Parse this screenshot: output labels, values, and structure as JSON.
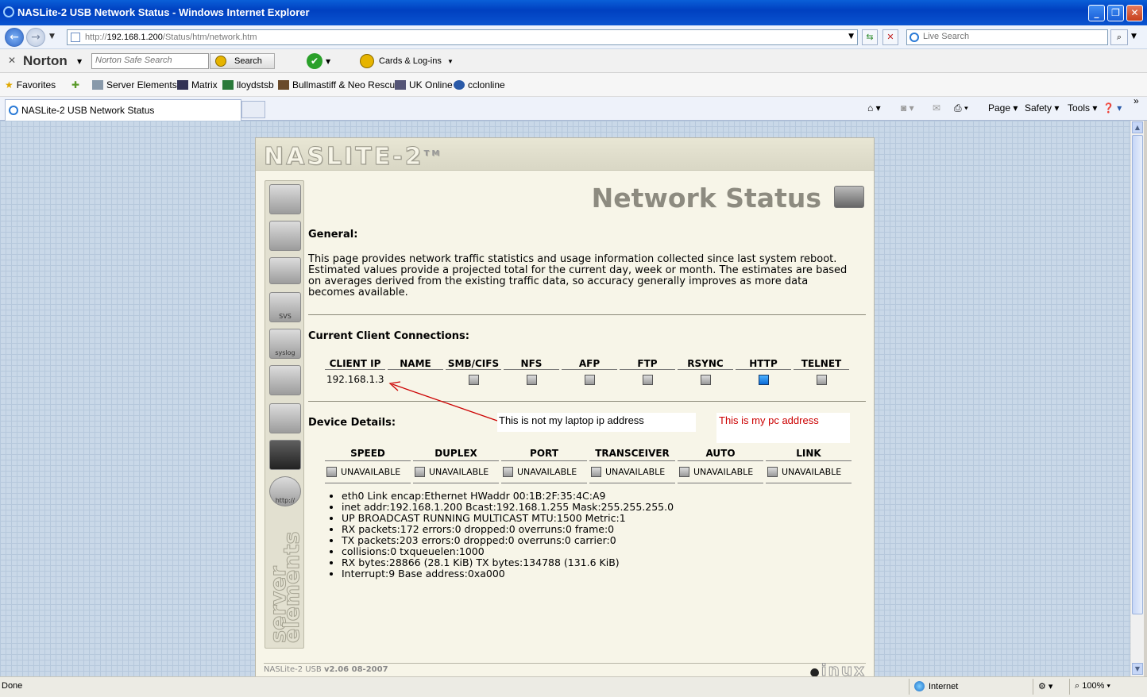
{
  "window": {
    "title": "NASLite-2 USB Network Status - Windows Internet Explorer"
  },
  "address": {
    "url_prefix": "http://",
    "url_host": "192.168.1.200",
    "url_path": "/Status/htm/network.htm",
    "search_placeholder": "Live Search"
  },
  "norton": {
    "brand": "Norton",
    "search_placeholder": "Norton Safe Search",
    "search_button": "Search",
    "cards_label": "Cards & Log-ins"
  },
  "favorites": {
    "label": "Favorites",
    "items": [
      "Server Elements",
      "Matrix",
      "lloydstsb",
      "Bullmastiff & Neo Rescue",
      "UK Online",
      "cclonline"
    ]
  },
  "tab": {
    "label": "NASLite-2 USB Network Status"
  },
  "commands": {
    "page": "Page",
    "safety": "Safety",
    "tools": "Tools"
  },
  "naslite": {
    "logo": "NASLITE-2",
    "tm": "TM",
    "sidebar_labels": {
      "svs": "SVS",
      "syslog": "syslog",
      "http": "http://"
    },
    "sidebar_vertical": "server elements",
    "page_title": "Network Status",
    "general_heading": "General:",
    "general_text": "This page provides network traffic statistics and usage information collected since last system reboot. Estimated values provide a projected total for the current day, week or month. The estimates are based on averages derived from the existing traffic data, so accuracy generally improves as more data becomes available.",
    "clients_heading": "Current Client Connections:",
    "client_columns": [
      "CLIENT IP",
      "NAME",
      "SMB/CIFS",
      "NFS",
      "AFP",
      "FTP",
      "RSYNC",
      "HTTP",
      "TELNET"
    ],
    "client_rows": [
      {
        "ip": "192.168.1.3",
        "name": "",
        "smb": false,
        "nfs": false,
        "afp": false,
        "ftp": false,
        "rsync": false,
        "http": true,
        "telnet": false
      }
    ],
    "device_heading": "Device Details:",
    "device_columns": [
      "SPEED",
      "DUPLEX",
      "PORT",
      "TRANSCEIVER",
      "AUTO",
      "LINK"
    ],
    "device_values": [
      "UNAVAILABLE",
      "UNAVAILABLE",
      "UNAVAILABLE",
      "UNAVAILABLE",
      "UNAVAILABLE",
      "UNAVAILABLE"
    ],
    "interface_lines": [
      "eth0 Link encap:Ethernet HWaddr 00:1B:2F:35:4C:A9",
      "inet addr:192.168.1.200 Bcast:192.168.1.255 Mask:255.255.255.0",
      "UP BROADCAST RUNNING MULTICAST MTU:1500 Metric:1",
      "RX packets:172 errors:0 dropped:0 overruns:0 frame:0",
      "TX packets:203 errors:0 dropped:0 overruns:0 carrier:0",
      "collisions:0 txqueuelen:1000",
      "RX bytes:28866 (28.1 KiB) TX bytes:134788 (131.6 KiB)",
      "Interrupt:9 Base address:0xa000"
    ],
    "footer_prefix": "NASLite-2 USB ",
    "footer_version": "v2.06 08-2007",
    "footer_logo": "inux"
  },
  "annotations": {
    "note1": "This is not my laptop ip address",
    "note2": "This is my pc address",
    "note1_color": "#000000",
    "note2_color": "#cc0000",
    "arrow_color": "#cc0000"
  },
  "statusbar": {
    "status": "Done",
    "zone": "Internet",
    "zoom": "100%"
  },
  "colors": {
    "titlebar": "#0040c0",
    "page_bg": "#c9d8e8",
    "panel_bg": "#f7f5e8"
  }
}
